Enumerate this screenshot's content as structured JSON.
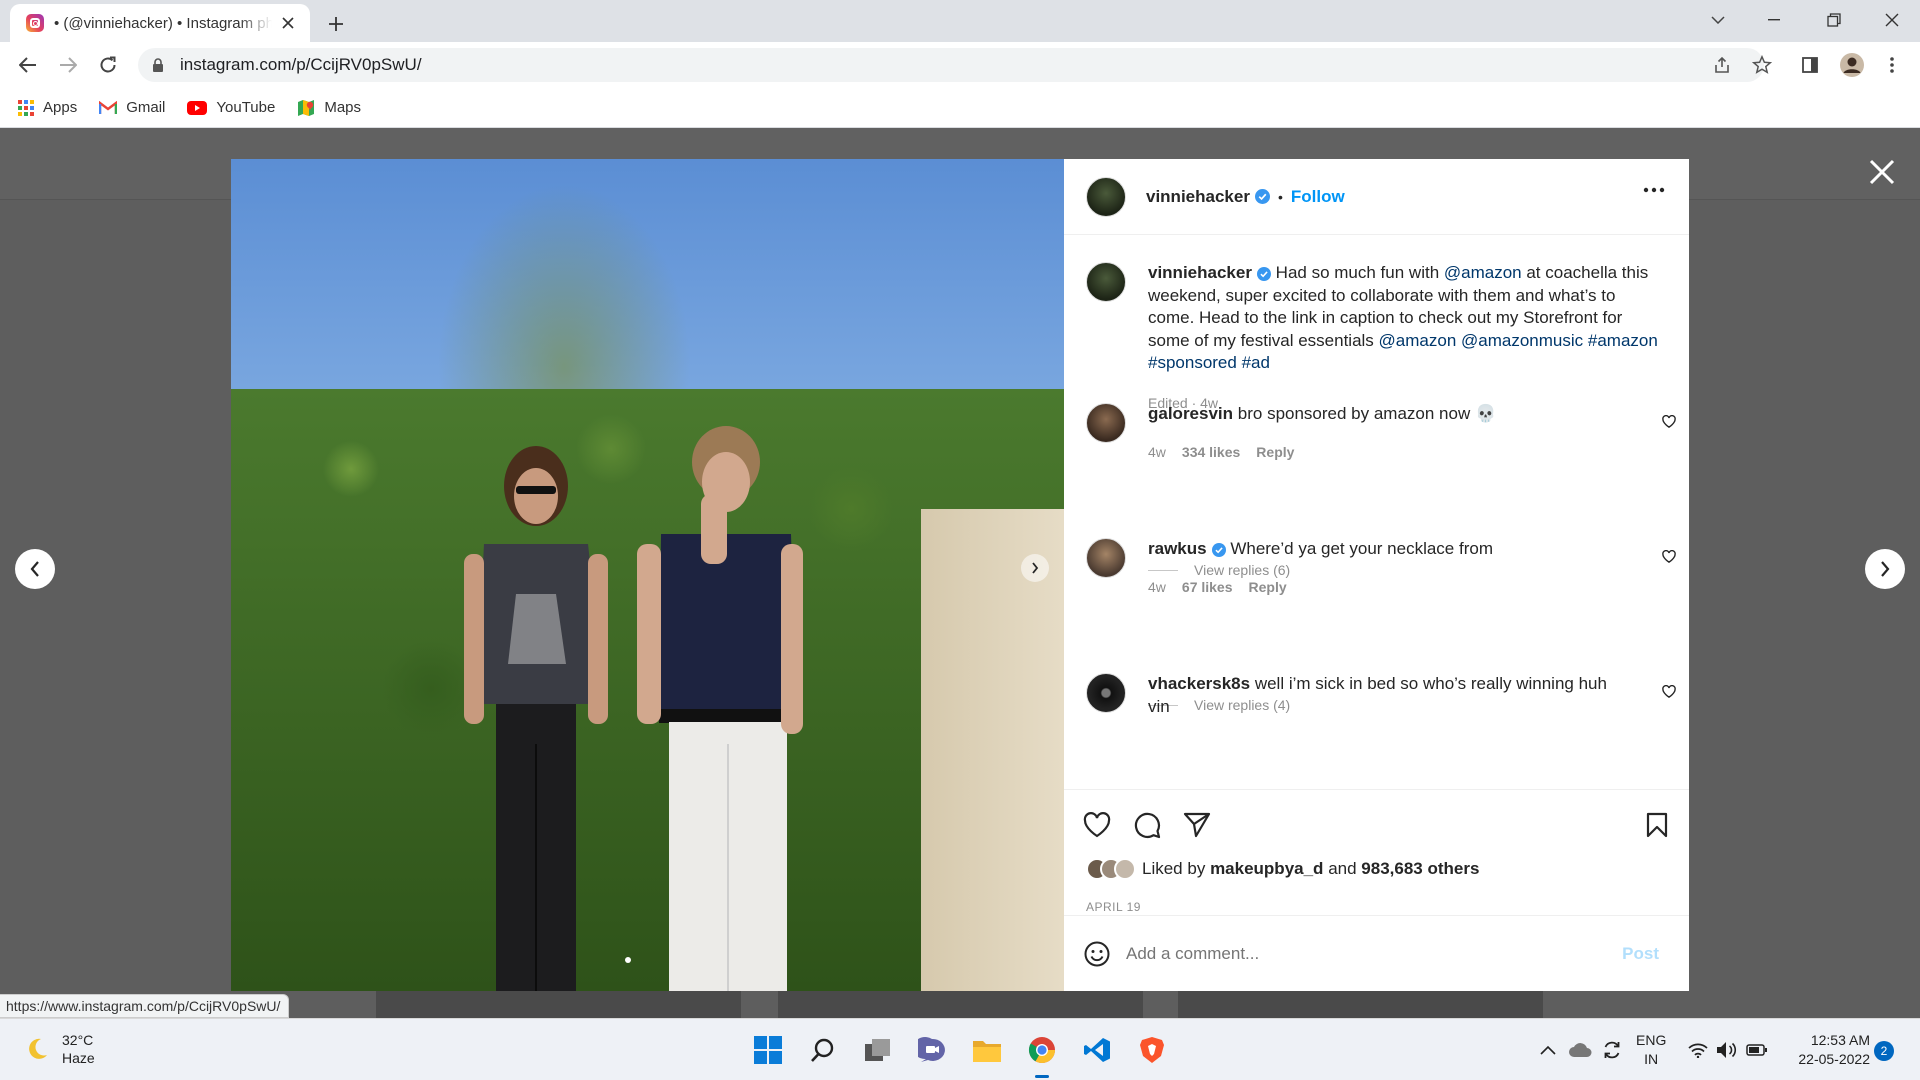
{
  "browser": {
    "tab_title": "• (@vinniehacker) • Instagram photos",
    "url": "instagram.com/p/CcijRV0pSwU/",
    "bookmarks": [
      {
        "label": "Apps",
        "icon": "apps-grid-icon"
      },
      {
        "label": "Gmail",
        "icon": "gmail-icon"
      },
      {
        "label": "YouTube",
        "icon": "youtube-icon"
      },
      {
        "label": "Maps",
        "icon": "maps-icon"
      }
    ],
    "status_url": "https://www.instagram.com/p/CcijRV0pSwU/"
  },
  "post": {
    "author": "vinniehacker",
    "follow_label": "Follow",
    "dot": "•",
    "caption": {
      "username": "vinniehacker",
      "text_1": " Had so much fun with ",
      "mention_1": "@amazon",
      "text_2": " at coachella this weekend, super excited to collaborate with them and what’s to come. Head to the link in caption to check out my Storefront for some of my festival essentials ",
      "mention_2": "@amazon",
      "mention_3": "@amazonmusic",
      "tag_1": "#amazon",
      "tag_2": "#sponsored",
      "tag_3": "#ad",
      "meta": "Edited · 4w"
    },
    "comments": [
      {
        "username": "galoresvin",
        "text": " bro sponsored by amazon now 💀",
        "time": "4w",
        "likes": "334 likes",
        "reply": "Reply",
        "view_replies": "View replies (6)"
      },
      {
        "username": "rawkus",
        "text": " Where’d ya get your necklace from",
        "time": "4w",
        "likes": "67 likes",
        "reply": "Reply",
        "view_replies": "View replies (4)"
      },
      {
        "username": "vhackersk8s",
        "text": " well i’m sick in bed so who’s really winning huh vin"
      }
    ],
    "liked_by_prefix": "Liked by ",
    "liked_by_user": "makeupbya_d",
    "liked_by_and": " and ",
    "liked_by_others": "983,683 others",
    "date": "APRIL 19",
    "comment_placeholder": "Add a comment...",
    "post_label": "Post"
  },
  "taskbar": {
    "temp": "32°C",
    "weather": "Haze",
    "lang_1": "ENG",
    "lang_2": "IN",
    "time": "12:53 AM",
    "date": "22-05-2022",
    "notifications": "2"
  },
  "colors": {
    "accent": "#0095f6",
    "link": "#00376b",
    "overlay": "#5e5e5e"
  }
}
